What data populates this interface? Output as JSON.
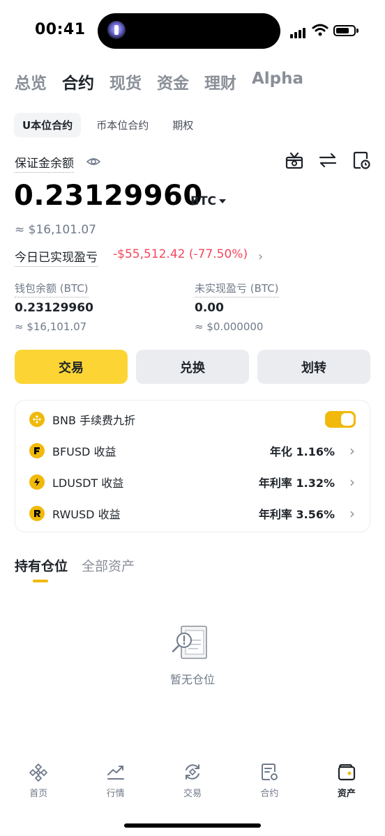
{
  "status_bar": {
    "time": "00:41"
  },
  "top_nav": [
    "总览",
    "合约",
    "现货",
    "资金",
    "理财",
    "Alpha"
  ],
  "top_nav_active": "合约",
  "sub_tabs": [
    "U本位合约",
    "币本位合约",
    "期权"
  ],
  "sub_tabs_active": "U本位合约",
  "balance": {
    "label": "保证金余额",
    "value": "0.23129960",
    "unit": "BTC",
    "usd": "≈ $16,101.07",
    "pnl_label": "今日已实现盈亏",
    "pnl_value": "-$55,512.42 (-77.50%)",
    "pnl_chevron": "›"
  },
  "wallet": {
    "label": "钱包余额 (BTC)",
    "value": "0.23129960",
    "usd": "≈ $16,101.07"
  },
  "unrealized": {
    "label": "未实现盈亏 (BTC)",
    "value": "0.00",
    "usd": "≈ $0.000000"
  },
  "actions": {
    "trade": "交易",
    "convert": "兑换",
    "transfer": "划转"
  },
  "promos": [
    {
      "label": "BNB 手续费九折",
      "value": "",
      "coin": "bnb"
    },
    {
      "label": "BFUSD 收益",
      "value": "年化 1.16%",
      "coin": "bfusd"
    },
    {
      "label": "LDUSDT 收益",
      "value": "年利率 1.32%",
      "coin": "ldusdt"
    },
    {
      "label": "RWUSD 收益",
      "value": "年利率 3.56%",
      "coin": "rwusd"
    }
  ],
  "promo_toggle_on": true,
  "position_tabs": [
    "持有仓位",
    "全部资产"
  ],
  "position_tabs_active": "持有仓位",
  "empty": {
    "text": "暂无仓位"
  },
  "bottom_nav": [
    "首页",
    "行情",
    "交易",
    "合约",
    "资产"
  ],
  "bottom_nav_active": "资产",
  "colors": {
    "brand": "#fcd535",
    "brand_dark": "#f0b90b",
    "loss": "#f6465d",
    "text": "#1e2329",
    "muted": "#707a8a"
  }
}
